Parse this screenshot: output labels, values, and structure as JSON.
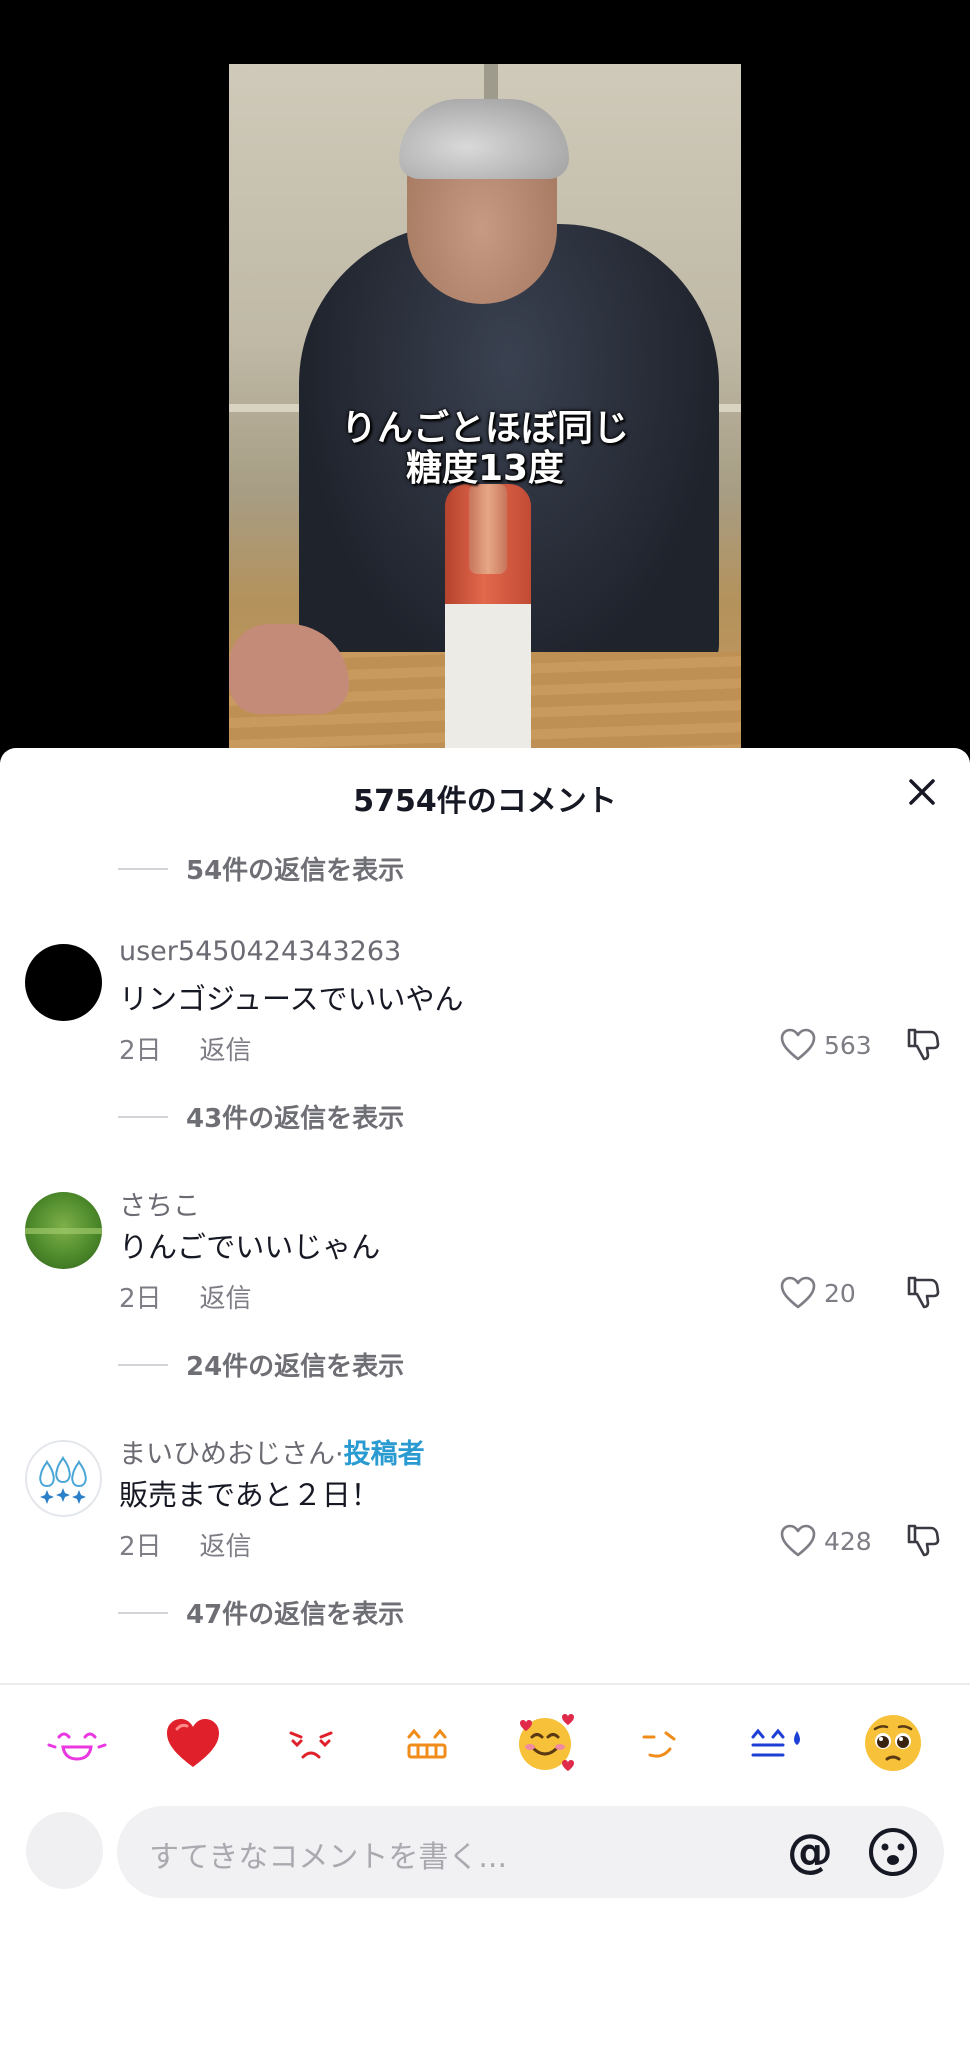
{
  "video": {
    "caption_line1": "りんごとほぼ同じ",
    "caption_line2": "糖度13度"
  },
  "sheet": {
    "title": "5754件のコメント"
  },
  "top_replies": {
    "label": "54件の返信を表示"
  },
  "comments": [
    {
      "username": "user5450424343263",
      "text": "リンゴジュースでいいやん",
      "time": "2日",
      "reply_label": "返信",
      "likes": "563",
      "replies_label": "43件の返信を表示",
      "avatar_color": "#000000"
    },
    {
      "username": "さちこ",
      "text": "りんごでいいじゃん",
      "time": "2日",
      "reply_label": "返信",
      "likes": "20",
      "replies_label": "24件の返信を表示",
      "avatar_color": "#4d8a2b"
    },
    {
      "username": "まいひめおじさん",
      "separator": "·",
      "author_badge": "投稿者",
      "text": "販売まであと２日！",
      "time": "2日",
      "reply_label": "返信",
      "likes": "428",
      "replies_label": "47件の返信を表示",
      "avatar_color": "#e7f2f8"
    }
  ],
  "emoji_bar": {
    "items": [
      "laughing-kaomoji",
      "heart",
      "sad-kaomoji",
      "grin-kaomoji",
      "smiling-face-with-hearts",
      "wink-kaomoji",
      "sweat-kaomoji",
      "pleading-face"
    ],
    "colors": {
      "pink": "#ea37e0",
      "red": "#e0202a",
      "orange": "#f08c1a",
      "blue": "#1d3fd6"
    }
  },
  "composer": {
    "placeholder": "すてきなコメントを書く...",
    "at_symbol": "@"
  },
  "colors": {
    "author_badge": "#2a9bd1",
    "secondary_text": "#7d7d85"
  }
}
